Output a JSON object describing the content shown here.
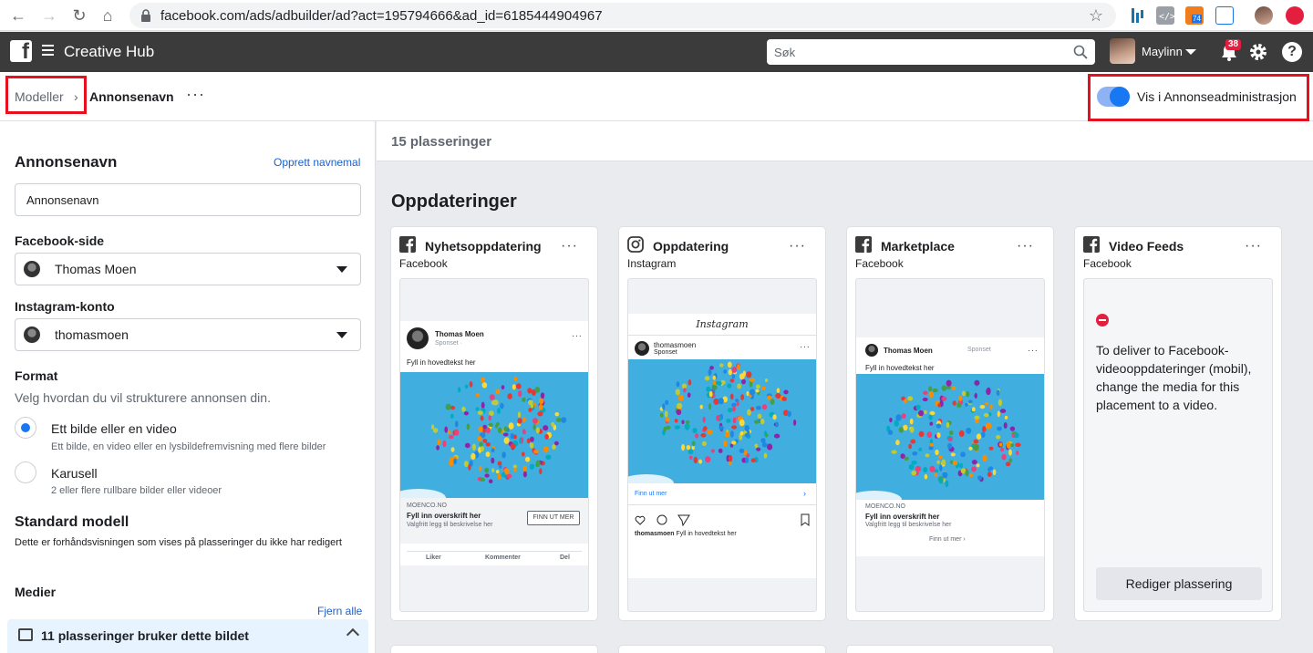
{
  "browser": {
    "url": "facebook.com/ads/adbuilder/ad?act=195794666&ad_id=6185444904967",
    "extension_badge": "74"
  },
  "topbar": {
    "app_title": "Creative Hub",
    "search_placeholder": "Søk",
    "user_name": "Maylinn",
    "notifications_count": "38"
  },
  "breadcrumb": {
    "parent": "Modeller",
    "separator": "›",
    "current": "Annonsenavn",
    "more": "···"
  },
  "toggle": {
    "label": "Vis i Annonseadministrasjon",
    "on": true
  },
  "left_panel": {
    "title": "Annonsenavn",
    "create_template_link": "Opprett navnemal",
    "ad_name_value": "Annonsenavn",
    "facebook_page_label": "Facebook-side",
    "facebook_page_value": "Thomas Moen",
    "instagram_label": "Instagram-konto",
    "instagram_value": "thomasmoen",
    "format_label": "Format",
    "format_desc": "Velg hvordan du vil strukturere annonsen din.",
    "format_options": [
      {
        "label": "Ett bilde eller en video",
        "sub": "Ett bilde, en video eller en lysbildefremvisning med flere bilder",
        "selected": true
      },
      {
        "label": "Karusell",
        "sub": "2 eller flere rullbare bilder eller videoer",
        "selected": false
      }
    ],
    "standard_title": "Standard modell",
    "standard_desc": "Dette er forhåndsvisningen som vises på plasseringer du ikke har redigert",
    "media_label": "Medier",
    "remove_all": "Fjern alle",
    "media_banner": "11 plasseringer bruker dette bildet"
  },
  "right_panel": {
    "placements_count": "15 plasseringer",
    "section_title": "Oppdateringer"
  },
  "cards": [
    {
      "title": "Nyhetsoppdatering",
      "platform": "Facebook",
      "preview": {
        "name": "Thomas Moen",
        "sponsored": "Sponset · ",
        "body": "Fyll in hovedtekst her",
        "domain": "MOENCO.NO",
        "headline": "Fyll inn overskrift her",
        "desc": "Valgfritt legg til beskrivelse her",
        "cta": "FINN UT MER",
        "actions": [
          "Liker",
          "Kommenter",
          "Del"
        ]
      }
    },
    {
      "title": "Oppdatering",
      "platform": "Instagram",
      "preview": {
        "brand": "Instagram",
        "name": "thomasmoen",
        "sponsored": "Sponset",
        "cta": "Finn ut mer",
        "caption_name": "thomasmoen",
        "caption": "Fyll in hovedtekst her"
      }
    },
    {
      "title": "Marketplace",
      "platform": "Facebook",
      "preview": {
        "name": "Thomas Moen",
        "sponsored": "Sponset",
        "body": "Fyll in hovedtekst her",
        "domain": "MOENCO.NO",
        "headline": "Fyll inn overskrift her",
        "desc": "Valgfritt legg til beskrivelse her",
        "cta": "Finn ut mer"
      }
    },
    {
      "title": "Video Feeds",
      "platform": "Facebook",
      "message": "To deliver to Facebook-videooppdateringer (mobil), change the media for this placement to a video.",
      "button": "Rediger plassering"
    }
  ],
  "colors": {
    "accent": "#1877f2",
    "link": "#1d5fc9",
    "topbar": "#3b3b3b",
    "highlight_box": "#e8101f",
    "error": "#e41e3f"
  }
}
